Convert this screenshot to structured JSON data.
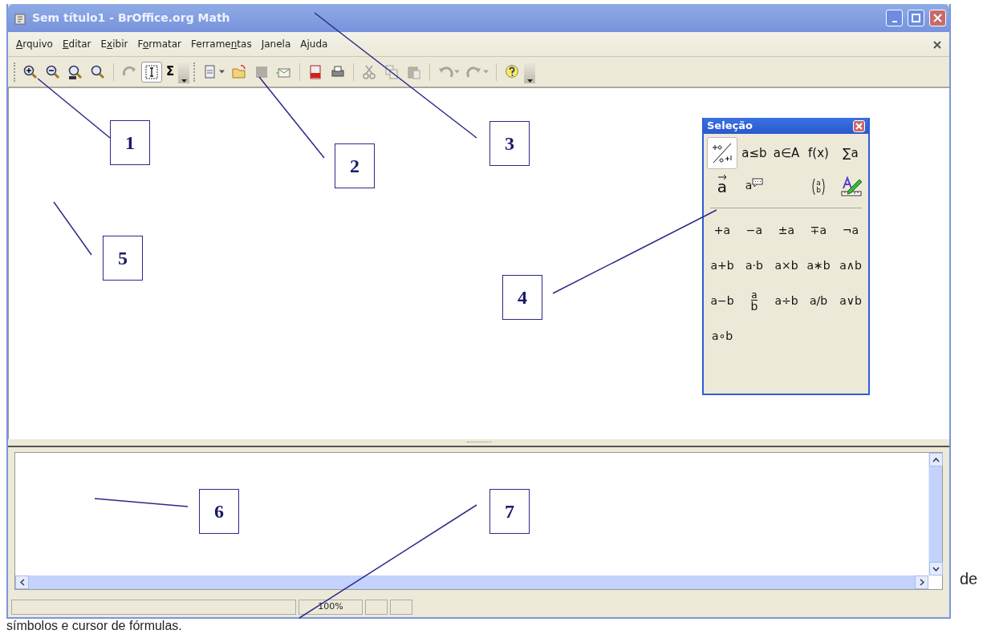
{
  "window": {
    "title": "Sem título1 - BrOffice.org Math"
  },
  "menu": [
    {
      "key": "A",
      "post": "rquivo"
    },
    {
      "key": "E",
      "post": "ditar"
    },
    {
      "pre": "E",
      "key": "x",
      "post": "ibir"
    },
    {
      "pre": "F",
      "key": "o",
      "post": "rmatar"
    },
    {
      "pre": "Ferrame",
      "key": "n",
      "post": "tas"
    },
    {
      "key": "J",
      "post": "anela"
    },
    {
      "pre": "A",
      "key": "j",
      "post": "uda"
    }
  ],
  "toolbar": [
    {
      "kind": "handle"
    },
    {
      "kind": "zoom-in",
      "disabled": false
    },
    {
      "kind": "zoom-out",
      "disabled": false
    },
    {
      "kind": "zoom-100",
      "disabled": false
    },
    {
      "kind": "zoom-all",
      "disabled": false
    },
    {
      "kind": "separator"
    },
    {
      "kind": "update",
      "disabled": true
    },
    {
      "kind": "formula-cursor",
      "disabled": false,
      "selected": true
    },
    {
      "kind": "symbol",
      "label": "Σ",
      "disabled": false,
      "selected": false
    },
    {
      "kind": "overflow"
    },
    {
      "kind": "handle"
    },
    {
      "kind": "new",
      "disabled": false,
      "dropdown": true
    },
    {
      "kind": "open",
      "disabled": false
    },
    {
      "kind": "save",
      "disabled": true
    },
    {
      "kind": "email",
      "disabled": false
    },
    {
      "kind": "separator"
    },
    {
      "kind": "pdf",
      "disabled": false
    },
    {
      "kind": "print",
      "disabled": false
    },
    {
      "kind": "separator"
    },
    {
      "kind": "cut",
      "disabled": true
    },
    {
      "kind": "copy",
      "disabled": true
    },
    {
      "kind": "paste",
      "disabled": true
    },
    {
      "kind": "separator"
    },
    {
      "kind": "undo",
      "disabled": true,
      "dropdown": true
    },
    {
      "kind": "redo",
      "disabled": true,
      "dropdown": true
    },
    {
      "kind": "separator"
    },
    {
      "kind": "help",
      "disabled": false
    },
    {
      "kind": "overflow"
    }
  ],
  "selection_panel": {
    "title": "Seleção",
    "categories": [
      {
        "kind": "unary-binary",
        "selected": true
      },
      {
        "kind": "text",
        "label": "a≤b",
        "selected": false
      },
      {
        "kind": "text",
        "label": "a∈A",
        "selected": false
      },
      {
        "kind": "text",
        "label": "f(x)",
        "selected": false
      },
      {
        "kind": "text",
        "label": "∑a",
        "selected": false
      },
      {
        "kind": "vector",
        "label": "a",
        "selected": false
      },
      {
        "kind": "others",
        "label": "a",
        "selected": false
      },
      {
        "kind": "empty"
      },
      {
        "kind": "brackets",
        "numerator": "a",
        "denominator": "b",
        "selected": false
      },
      {
        "kind": "format",
        "selected": false
      }
    ],
    "symbols": [
      {
        "kind": "text",
        "label": "+a"
      },
      {
        "kind": "text",
        "label": "−a"
      },
      {
        "kind": "text",
        "label": "±a"
      },
      {
        "kind": "text",
        "label": "∓a"
      },
      {
        "kind": "text",
        "label": "¬a"
      },
      {
        "kind": "text",
        "label": "a+b"
      },
      {
        "kind": "text",
        "label": "a⋅b"
      },
      {
        "kind": "text",
        "label": "a×b"
      },
      {
        "kind": "text",
        "label": "a∗b"
      },
      {
        "kind": "text",
        "label": "a∧b"
      },
      {
        "kind": "text",
        "label": "a−b"
      },
      {
        "kind": "fraction",
        "numerator": "a",
        "denominator": "b"
      },
      {
        "kind": "text",
        "label": "a÷b"
      },
      {
        "kind": "text",
        "label": "a/b"
      },
      {
        "kind": "text",
        "label": "a∨b"
      },
      {
        "kind": "text",
        "label": "a∘b"
      }
    ]
  },
  "status_bar": [
    {
      "kind": "wide"
    },
    {
      "kind": "zoom",
      "label": "100%"
    },
    {
      "kind": "small"
    },
    {
      "kind": "small"
    }
  ],
  "callouts": [
    {
      "label": "1"
    },
    {
      "label": "2"
    },
    {
      "label": "3"
    },
    {
      "label": "4"
    },
    {
      "label": "5"
    },
    {
      "label": "6"
    },
    {
      "label": "7"
    }
  ],
  "caption": {
    "tail": "de",
    "line": "símbolos e cursor de fórmulas."
  }
}
